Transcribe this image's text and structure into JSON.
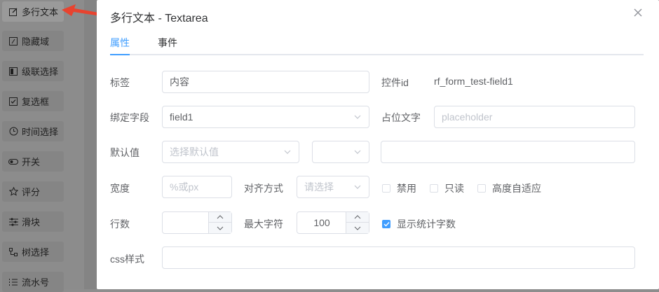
{
  "palette": {
    "items": [
      {
        "label": "多行文本",
        "icon": "edit-icon"
      },
      {
        "label": "隐藏域",
        "icon": "hidden-field-icon"
      },
      {
        "label": "级联选择",
        "icon": "cascader-icon"
      },
      {
        "label": "复选框",
        "icon": "checkbox-icon"
      },
      {
        "label": "时间选择",
        "icon": "clock-icon"
      },
      {
        "label": "开关",
        "icon": "switch-icon"
      },
      {
        "label": "评分",
        "icon": "star-icon"
      },
      {
        "label": "滑块",
        "icon": "slider-icon"
      },
      {
        "label": "树选择",
        "icon": "tree-icon"
      },
      {
        "label": "流水号",
        "icon": "list-icon"
      }
    ]
  },
  "dialog": {
    "title": "多行文本 - Textarea",
    "tabs": [
      {
        "label": "属性"
      },
      {
        "label": "事件"
      }
    ],
    "fields": {
      "label_label": "标签",
      "label_value": "内容",
      "control_id_label": "控件id",
      "control_id_value": "rf_form_test-field1",
      "bind_field_label": "绑定字段",
      "bind_field_value": "field1",
      "placeholder_label": "占位文字",
      "placeholder_placeholder": "placeholder",
      "default_label": "默认值",
      "default_placeholder": "选择默认值",
      "width_label": "宽度",
      "width_placeholder": "%或px",
      "align_label": "对齐方式",
      "align_placeholder": "请选择",
      "disabled_label": "禁用",
      "readonly_label": "只读",
      "autosize_label": "高度自适应",
      "rows_label": "行数",
      "maxlength_label": "最大字符",
      "maxlength_value": "100",
      "show_count_label": "显示统计字数",
      "css_label": "css样式"
    }
  },
  "colors": {
    "accent": "#409eff",
    "annotation_arrow": "#e8432f"
  }
}
